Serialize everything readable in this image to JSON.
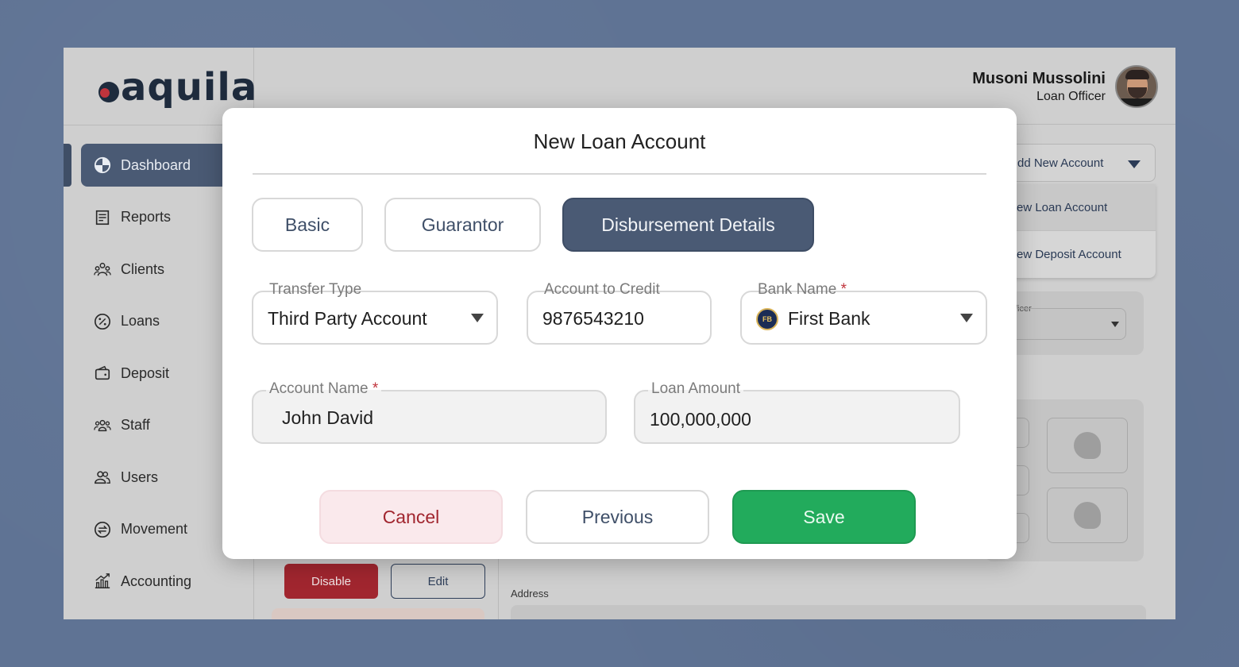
{
  "app": {
    "logo": "aquila"
  },
  "header": {
    "user_name": "Musoni Mussolini",
    "user_role": "Loan Officer"
  },
  "sidebar": {
    "items": [
      {
        "label": "Dashboard",
        "icon": "pie-chart-icon",
        "active": true
      },
      {
        "label": "Reports",
        "icon": "report-icon"
      },
      {
        "label": "Clients",
        "icon": "clients-icon"
      },
      {
        "label": "Loans",
        "icon": "percent-icon"
      },
      {
        "label": "Deposit",
        "icon": "wallet-icon"
      },
      {
        "label": "Staff",
        "icon": "staff-icon"
      },
      {
        "label": "Users",
        "icon": "users-icon"
      },
      {
        "label": "Movement",
        "icon": "movement-icon"
      },
      {
        "label": "Accounting",
        "icon": "accounting-icon"
      }
    ]
  },
  "background": {
    "add_account_label": "dd New Account",
    "menu": [
      "ew Loan Account",
      "ew Deposit Account"
    ],
    "officer_label": "ficer",
    "disable_label": "Disable",
    "edit_label": "Edit",
    "address_label": "Address"
  },
  "modal": {
    "title": "New Loan Account",
    "tabs": [
      {
        "label": "Basic",
        "active": false
      },
      {
        "label": "Guarantor",
        "active": false
      },
      {
        "label": "Disbursement Details",
        "active": true
      }
    ],
    "fields": {
      "transfer_type": {
        "label": "Transfer Type",
        "value": "Third Party Account"
      },
      "account_to_credit": {
        "label": "Account to Credit",
        "value": "9876543210"
      },
      "bank_name": {
        "label": "Bank Name",
        "required_mark": "*",
        "value": "First Bank"
      },
      "account_name": {
        "label": "Account Name",
        "required_mark": "*",
        "value": "John David"
      },
      "loan_amount": {
        "label": "Loan Amount",
        "value": "100,000,000"
      }
    },
    "buttons": {
      "cancel": "Cancel",
      "previous": "Previous",
      "save": "Save"
    }
  },
  "colors": {
    "primary": "#4a5a74",
    "danger": "#a1262f",
    "success": "#22ab5c",
    "required": "#c0343c"
  }
}
